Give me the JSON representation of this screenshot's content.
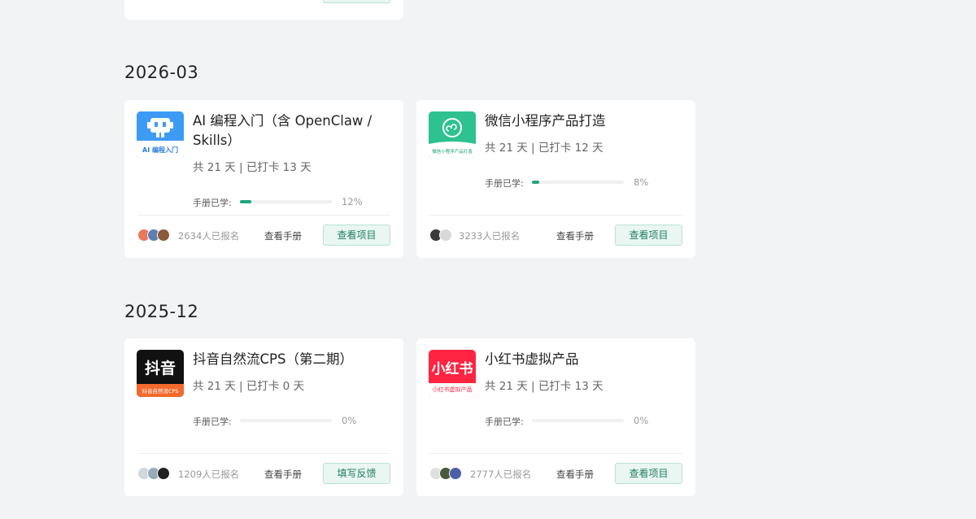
{
  "sections": [
    {
      "month": "2026-03",
      "cards": [
        {
          "title": "AI 编程入门（含 OpenClaw / Skills）",
          "meta": "共 21 天 | 已打卡 13 天",
          "progress_label": "手册已学:",
          "progress_pct": "12%",
          "progress_value": 0.12,
          "signups": "2634人已报名",
          "manual_link": "查看手册",
          "action": "查看项目",
          "thumb": {
            "icon": "robot-icon",
            "caption": "AI 编程入门",
            "bg": "#3d9bf6"
          }
        },
        {
          "title": "微信小程序产品打造",
          "meta": "共 21 天 | 已打卡 12 天",
          "progress_label": "手册已学:",
          "progress_pct": "8%",
          "progress_value": 0.08,
          "signups": "3233人已报名",
          "manual_link": "查看手册",
          "action": "查看项目",
          "thumb": {
            "icon": "mini-program-icon",
            "caption": "微信小程序产品打造",
            "bg": "#2dc28f"
          }
        }
      ]
    },
    {
      "month": "2025-12",
      "cards": [
        {
          "title": "抖音自然流CPS（第二期）",
          "meta": "共 21 天 | 已打卡 0 天",
          "progress_label": "手册已学:",
          "progress_pct": "0%",
          "progress_value": 0,
          "signups": "1209人已报名",
          "manual_link": "查看手册",
          "action": "填写反馈",
          "thumb": {
            "logo": "抖音",
            "caption": "抖音自然流CPS",
            "bg": "#111111",
            "accent": "#f36a2d"
          }
        },
        {
          "title": "小红书虚拟产品",
          "meta": "共 21 天 | 已打卡 13 天",
          "progress_label": "手册已学:",
          "progress_pct": "0%",
          "progress_value": 0,
          "signups": "2777人已报名",
          "manual_link": "查看手册",
          "action": "查看项目",
          "thumb": {
            "logo": "小红书",
            "caption": "小红书虚拟产品",
            "bg": "#ff2442"
          }
        }
      ]
    }
  ],
  "colors": {
    "accent": "#20a57e",
    "button_bg": "#e9f6f2",
    "page_bg": "#f2f3f5"
  }
}
